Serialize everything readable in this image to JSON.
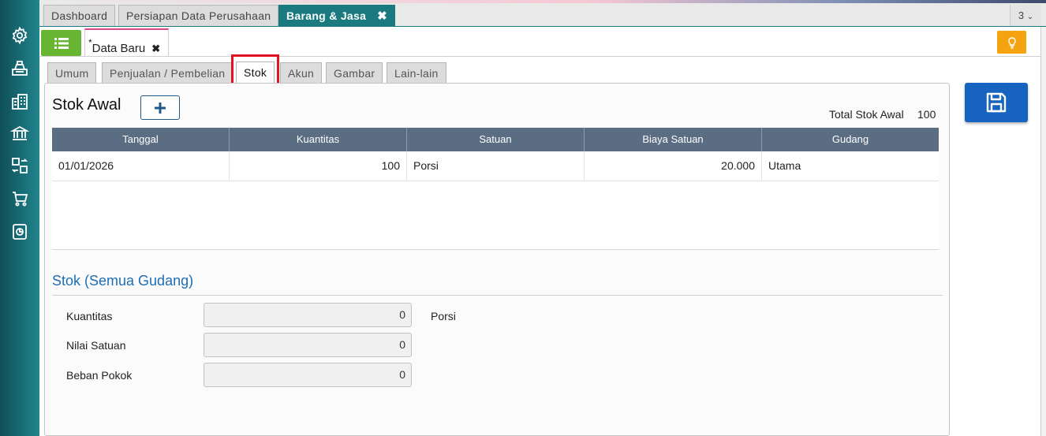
{
  "sidebar": {
    "icons": [
      "gear-icon",
      "cash-register-icon",
      "building-icon",
      "bank-icon",
      "transfer-icon",
      "cart-icon",
      "report-icon"
    ]
  },
  "main_tabs": [
    {
      "label": "Dashboard",
      "active": false
    },
    {
      "label": "Persiapan Data Perusahaan",
      "active": false
    },
    {
      "label": "Barang & Jasa",
      "active": true
    }
  ],
  "tab_count": "3",
  "sub_tab": {
    "modified_mark": "*",
    "label": "Data Baru"
  },
  "page_tabs": [
    {
      "label": "Umum"
    },
    {
      "label": "Penjualan / Pembelian"
    },
    {
      "label": "Stok",
      "active": true
    },
    {
      "label": "Akun"
    },
    {
      "label": "Gambar"
    },
    {
      "label": "Lain-lain"
    }
  ],
  "stok_awal": {
    "title": "Stok Awal",
    "add_label": "+",
    "total_label": "Total Stok Awal",
    "total_value": "100",
    "columns": [
      "Tanggal",
      "Kuantitas",
      "Satuan",
      "Biaya Satuan",
      "Gudang"
    ],
    "rows": [
      {
        "tanggal": "01/01/2026",
        "kuantitas": "100",
        "satuan": "Porsi",
        "biaya": "20.000",
        "gudang": "Utama"
      }
    ]
  },
  "stok_semua": {
    "title": "Stok (Semua Gudang)",
    "fields": [
      {
        "label": "Kuantitas",
        "value": "0"
      },
      {
        "label": "Nilai Satuan",
        "value": "0"
      },
      {
        "label": "Beban Pokok",
        "value": "0"
      }
    ],
    "unit": "Porsi"
  },
  "colors": {
    "accent": "#1a7a80",
    "active_tab_highlight": "#e0141e",
    "save_button": "#1663c0",
    "list_button": "#67b531",
    "hint_button": "#f5a30e",
    "grid_header": "#5b6d83",
    "section_title": "#1e6eb5"
  }
}
